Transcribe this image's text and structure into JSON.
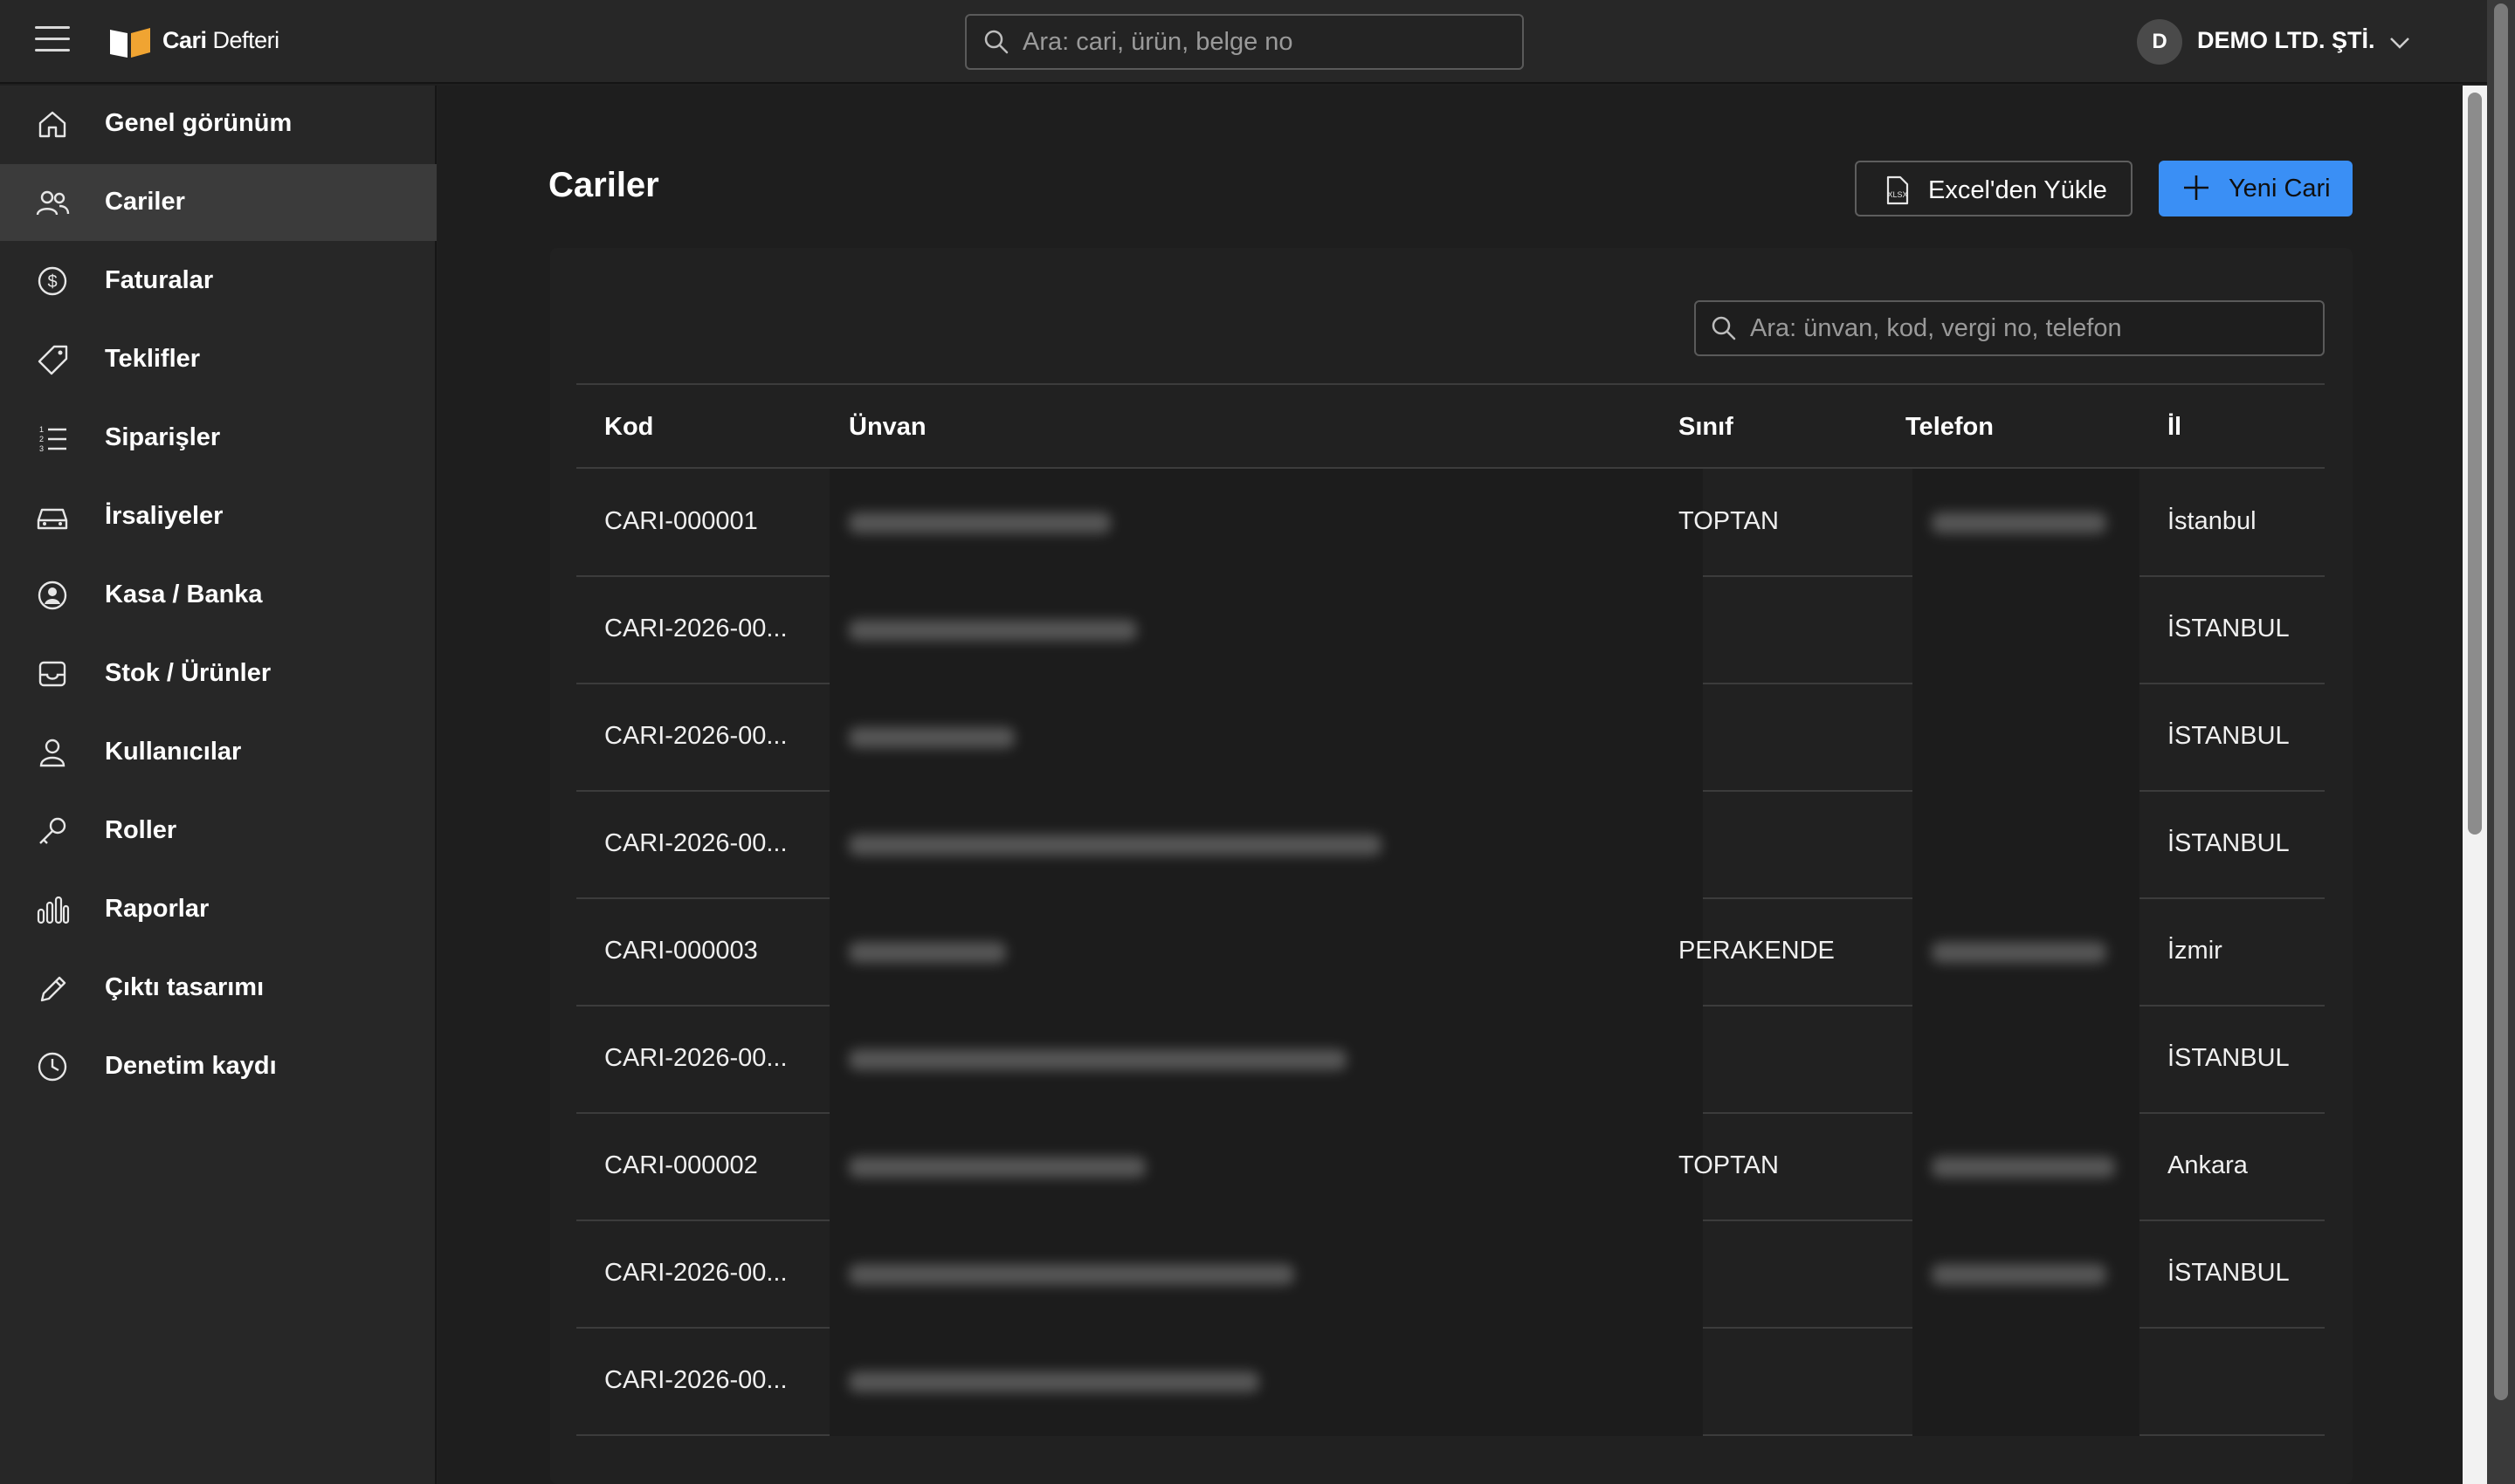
{
  "app": {
    "logo_bold": "Cari",
    "logo_light": "Defteri",
    "search_placeholder": "Ara: cari, ürün, belge no",
    "company_initial": "D",
    "company_name": "DEMO LTD. ŞTİ."
  },
  "sidebar": {
    "items": [
      {
        "label": "Genel görünüm",
        "icon": "home-icon",
        "active": false
      },
      {
        "label": "Cariler",
        "icon": "users-icon",
        "active": true
      },
      {
        "label": "Faturalar",
        "icon": "dollar-circle-icon",
        "active": false
      },
      {
        "label": "Teklifler",
        "icon": "tag-icon",
        "active": false
      },
      {
        "label": "Siparişler",
        "icon": "ordered-list-icon",
        "active": false
      },
      {
        "label": "İrsaliyeler",
        "icon": "car-icon",
        "active": false
      },
      {
        "label": "Kasa / Banka",
        "icon": "user-circle-icon",
        "active": false
      },
      {
        "label": "Stok / Ürünler",
        "icon": "inbox-icon",
        "active": false
      },
      {
        "label": "Kullanıcılar",
        "icon": "user-icon",
        "active": false
      },
      {
        "label": "Roller",
        "icon": "key-icon",
        "active": false
      },
      {
        "label": "Raporlar",
        "icon": "bar-chart-icon",
        "active": false
      },
      {
        "label": "Çıktı tasarımı",
        "icon": "pencil-icon",
        "active": false
      },
      {
        "label": "Denetim kaydı",
        "icon": "clock-icon",
        "active": false
      }
    ]
  },
  "page": {
    "title": "Cariler",
    "excel_button": "Excel'den Yükle",
    "new_button": "Yeni Cari",
    "table_search_placeholder": "Ara: ünvan, kod, vergi no, telefon"
  },
  "table": {
    "columns": {
      "kod": "Kod",
      "unvan": "Ünvan",
      "sinif": "Sınıf",
      "telefon": "Telefon",
      "il": "İl"
    },
    "rows": [
      {
        "kod": "CARI-000001",
        "sinif": "TOPTAN",
        "il": "İstanbul"
      },
      {
        "kod": "CARI-2026-00...",
        "sinif": "",
        "il": "İSTANBUL"
      },
      {
        "kod": "CARI-2026-00...",
        "sinif": "",
        "il": "İSTANBUL"
      },
      {
        "kod": "CARI-2026-00...",
        "sinif": "",
        "il": "İSTANBUL"
      },
      {
        "kod": "CARI-000003",
        "sinif": "PERAKENDE",
        "il": "İzmir"
      },
      {
        "kod": "CARI-2026-00...",
        "sinif": "",
        "il": "İSTANBUL"
      },
      {
        "kod": "CARI-000002",
        "sinif": "TOPTAN",
        "il": "Ankara"
      },
      {
        "kod": "CARI-2026-00...",
        "sinif": "",
        "il": "İSTANBUL"
      },
      {
        "kod": "CARI-2026-00...",
        "sinif": "",
        "il": ""
      }
    ]
  },
  "colors": {
    "accent": "#3a8ff5",
    "sidebar_bg": "#272727",
    "active_item_bg": "#3b3b3b",
    "main_bg": "#1e1e1e"
  }
}
